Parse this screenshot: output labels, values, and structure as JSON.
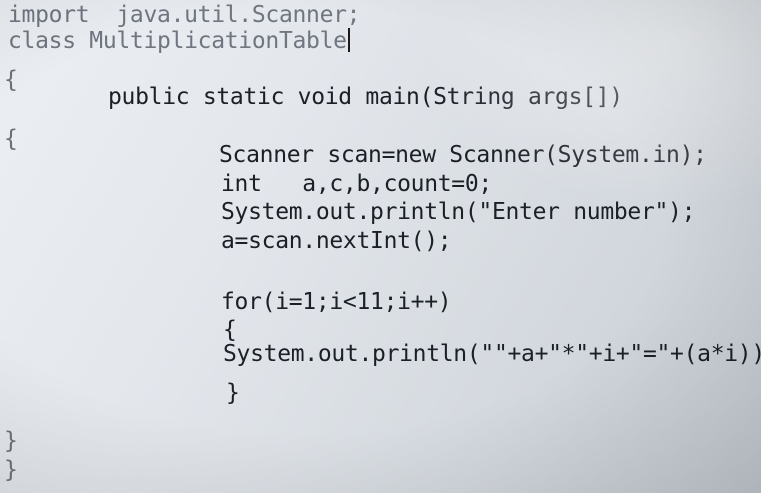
{
  "editor": {
    "lines": [
      "import  java.util.Scanner;",
      "class MultiplicationTable",
      "{",
      "public static void main(String args[])",
      "{",
      "Scanner scan=new Scanner(System.in);",
      "int   a,c,b,count=0;",
      "System.out.println(\"Enter number\");",
      "a=scan.nextInt();",
      "for(i=1;i<11;i++)",
      "{",
      "System.out.println(\"\"+a+\"*\"+i+\"=\"+(a*i));",
      "}",
      "}",
      "}"
    ]
  }
}
